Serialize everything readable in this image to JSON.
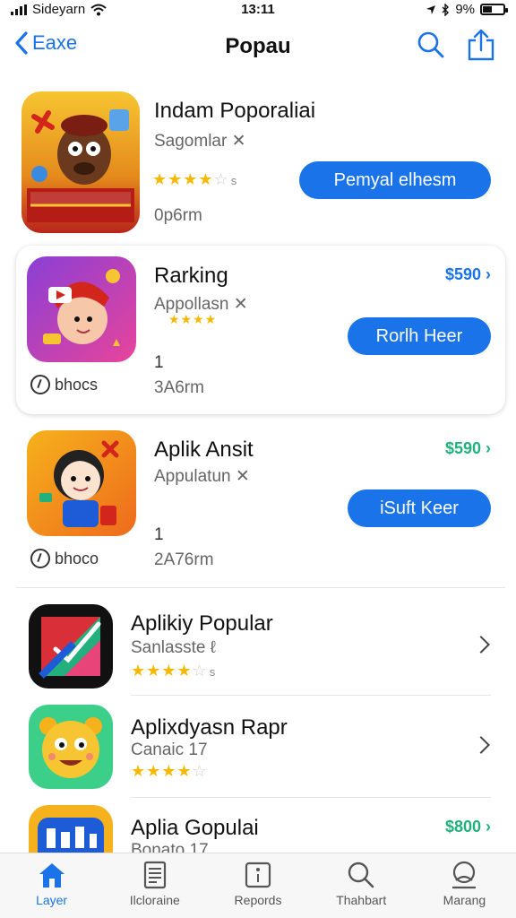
{
  "status": {
    "carrier": "Sideyarn",
    "time": "13:11",
    "battery": "9%"
  },
  "nav": {
    "back_label": "Eaxe",
    "title": "Popau"
  },
  "apps": [
    {
      "title": "Indam Poporaliai",
      "subtitle": "Sagomlar",
      "subtitle_mark": "✕",
      "stars_on": "★★★★",
      "stars_off": "☆",
      "rating_note": "s",
      "action_label": "Pemyal elhesm",
      "size": "0p6rm"
    },
    {
      "title": "Rarking",
      "subtitle": "Appollasn",
      "subtitle_mark": "✕",
      "stars_on": "★★★★",
      "price": "$590",
      "action_label": "Rorlh Heer",
      "count": "1",
      "size": "3A6rm",
      "badge": "bhocs"
    },
    {
      "title": "Aplik Ansit",
      "subtitle": "Appulatun",
      "subtitle_mark": "✕",
      "price": "$590",
      "action_label": "iSuft Keer",
      "count": "1",
      "size": "2A76rm",
      "badge": "bhoco"
    },
    {
      "title": "Aplikiy Popular",
      "subtitle": "Sanlasste",
      "subtitle_mark": "ℓ",
      "stars_on": "★★★★",
      "stars_off": "☆",
      "rating_note": "s"
    },
    {
      "title": "Aplixdyasn Rapr",
      "subtitle": "Canaic 17",
      "stars_on": "★★★★",
      "stars_off": "☆"
    },
    {
      "title": "Aplia Gopulai",
      "subtitle": "Bonato 17",
      "price": "$800"
    }
  ],
  "colors": {
    "accent": "#1a73e8",
    "price_blue": "#1a73e8",
    "price_green": "#22b07d",
    "star": "#f6b800"
  },
  "tabs": [
    {
      "label": "Layer",
      "icon": "home-icon"
    },
    {
      "label": "Ilcloraine",
      "icon": "document-icon"
    },
    {
      "label": "Repords",
      "icon": "report-icon"
    },
    {
      "label": "Thahbart",
      "icon": "search-icon"
    },
    {
      "label": "Marang",
      "icon": "profile-icon"
    }
  ]
}
